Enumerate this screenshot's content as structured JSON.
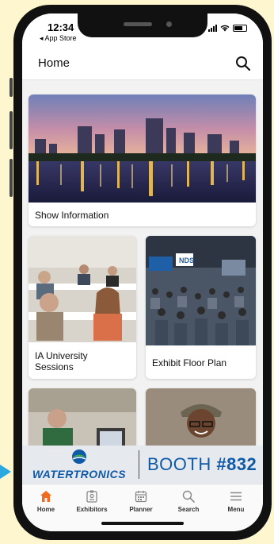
{
  "status_bar": {
    "time": "12:34",
    "back_label": "◂ App Store"
  },
  "header": {
    "title": "Home"
  },
  "cards": {
    "show_info": {
      "label": "Show Information"
    },
    "ia_university": {
      "label_line1": "IA University",
      "label_line2": "Sessions"
    },
    "exhibit_floor": {
      "label": "Exhibit Floor Plan",
      "sign_text": "NDS"
    }
  },
  "banner": {
    "brand": "WATERTRONICS",
    "booth_prefix": "BOOTH ",
    "booth_number": "#832",
    "brand_color": "#0f5aa8"
  },
  "tabs": [
    {
      "label": "Home",
      "icon": "home-icon",
      "active": true
    },
    {
      "label": "Exhibitors",
      "icon": "badge-icon",
      "active": false
    },
    {
      "label": "Planner",
      "icon": "calendar-icon",
      "active": false
    },
    {
      "label": "Search",
      "icon": "search-icon",
      "active": false
    },
    {
      "label": "Menu",
      "icon": "menu-icon",
      "active": false
    }
  ],
  "colors": {
    "accent": "#f26a21",
    "background": "#fdf6cf"
  }
}
